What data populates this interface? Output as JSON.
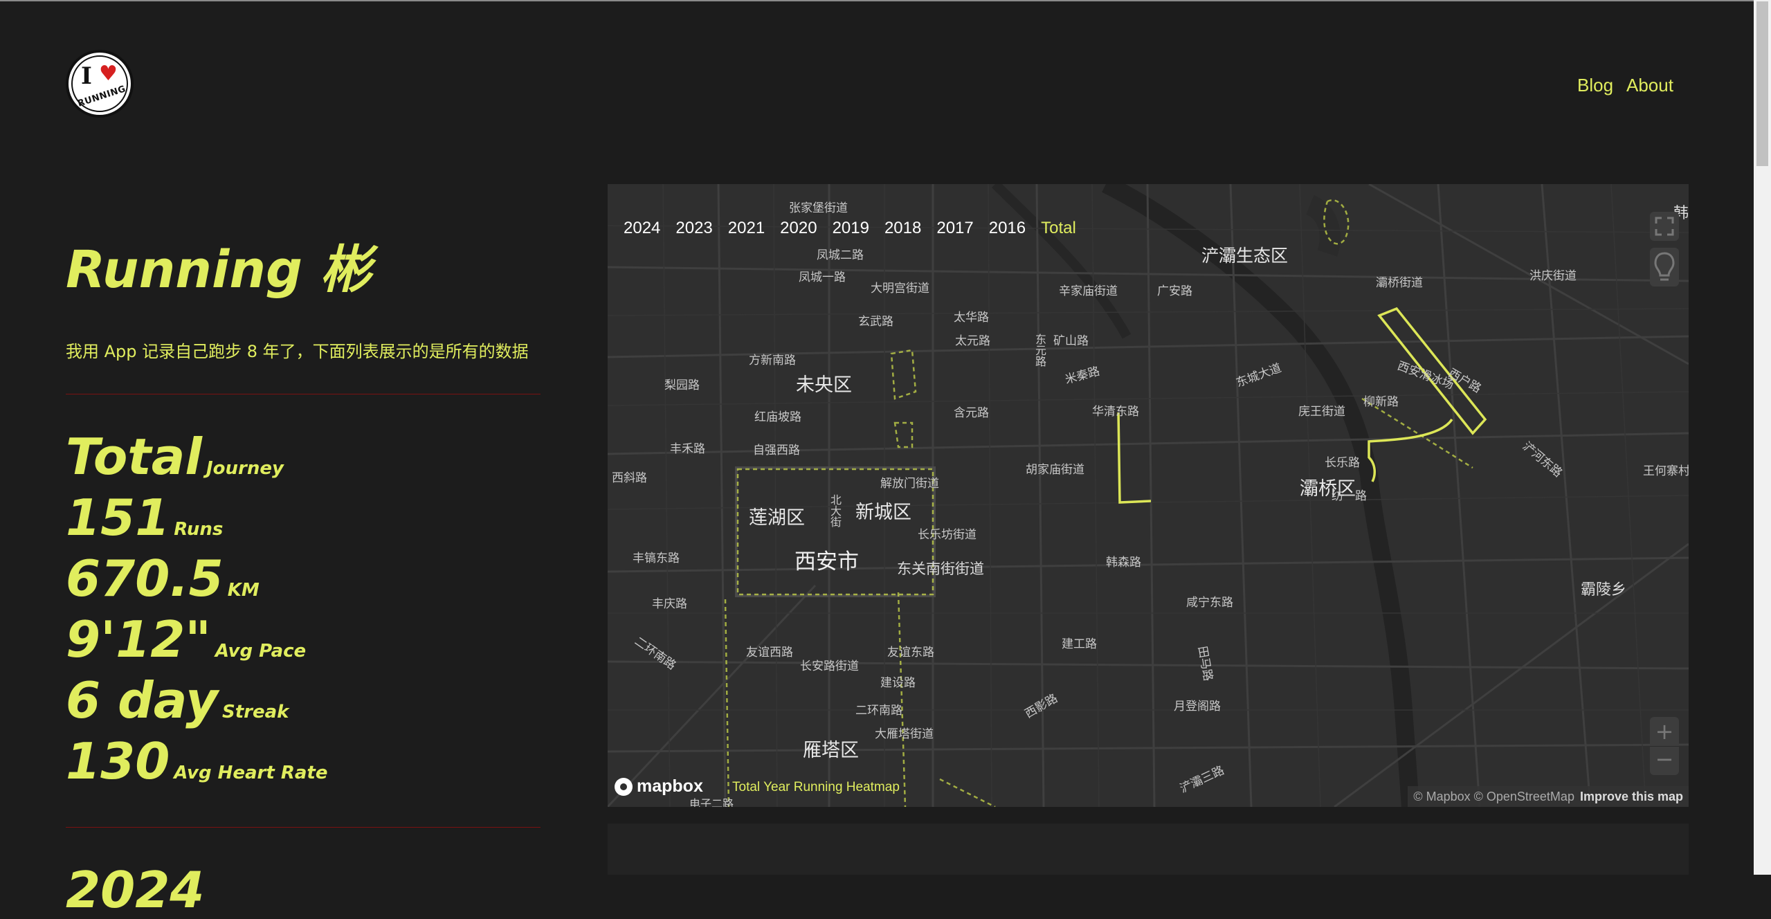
{
  "header": {
    "logo_alt": "I ♥ RUNNING",
    "logo_text": "RUNNING",
    "nav": [
      {
        "label": "Blog"
      },
      {
        "label": "About"
      }
    ]
  },
  "profile": {
    "title": "Running 彬",
    "description": "我用 App 记录自己跑步 8 年了，下面列表展示的是所有的数据"
  },
  "stats": {
    "total": {
      "value": "Total",
      "unit": "Journey"
    },
    "runs": {
      "value": "151",
      "unit": "Runs"
    },
    "distance": {
      "value": "670.5",
      "unit": "KM"
    },
    "pace": {
      "value": "9'12\"",
      "unit": "Avg Pace"
    },
    "streak": {
      "value": "6 day",
      "unit": "Streak"
    },
    "heart_rate": {
      "value": "130",
      "unit": "Avg Heart Rate"
    }
  },
  "next_section_year": "2024",
  "map": {
    "years": [
      "2024",
      "2023",
      "2021",
      "2020",
      "2019",
      "2018",
      "2017",
      "2016",
      "Total"
    ],
    "active_year": "Total",
    "heatmap_label": "Total Year Running Heatmap",
    "brand": "mapbox",
    "attribution": "© Mapbox © OpenStreetMap",
    "improve": "Improve this map",
    "controls": {
      "fullscreen": "fullscreen-icon",
      "light": "lightbulb-icon",
      "zoom_in": "+",
      "zoom_out": "−"
    },
    "labels": {
      "big": [
        "未央区",
        "莲湖区",
        "新城区",
        "西安市",
        "雁塔区",
        "灞桥区",
        "浐灞生态区",
        "霸陵乡"
      ],
      "small": [
        "张家堡街道",
        "凤城二路",
        "凤城一路",
        "大明宫街道",
        "玄武路",
        "太华路",
        "太元路",
        "方新南路",
        "梨园路",
        "红庙坡路",
        "自强西路",
        "丰禾路",
        "西斜路",
        "解放门街道",
        "长乐坊街道",
        "东关南街街道",
        "丰镐东路",
        "丰庆路",
        "二环南路",
        "友谊西路",
        "长安路街道",
        "友谊东路",
        "建设路",
        "二环南路",
        "大雁塔街道",
        "西影路",
        "胡家庙街道",
        "华清东路",
        "韩森路",
        "咸宁东路",
        "建工路",
        "田马路",
        "月登阁路",
        "长乐路",
        "纺一路",
        "浐灞三路",
        "辛家庙街道",
        "广安路",
        "矿山路",
        "米秦路",
        "东城大道",
        "灞桥街道",
        "洪庆街道",
        "庑王街道",
        "柳新路",
        "西安滑冰场",
        "西户路",
        "浐河东路",
        "王何寨村",
        "北大街",
        "含元路",
        "东元路",
        "电子二路"
      ],
      "edge": [
        "韩"
      ]
    }
  }
}
